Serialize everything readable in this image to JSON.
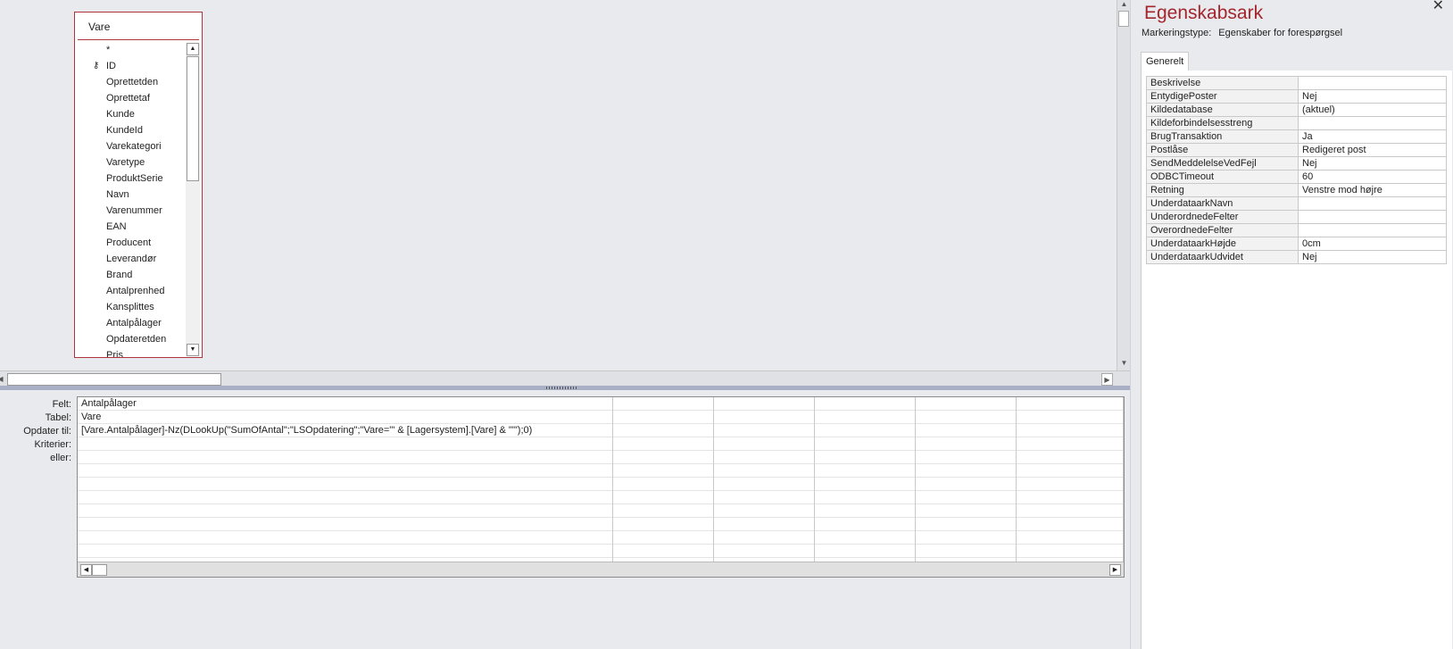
{
  "table_box": {
    "title": "Vare",
    "fields": [
      {
        "label": "*",
        "key": false
      },
      {
        "label": "ID",
        "key": true
      },
      {
        "label": "Oprettetden",
        "key": false
      },
      {
        "label": "Oprettetaf",
        "key": false
      },
      {
        "label": "Kunde",
        "key": false
      },
      {
        "label": "KundeId",
        "key": false
      },
      {
        "label": "Varekategori",
        "key": false
      },
      {
        "label": "Varetype",
        "key": false
      },
      {
        "label": "ProduktSerie",
        "key": false
      },
      {
        "label": "Navn",
        "key": false
      },
      {
        "label": "Varenummer",
        "key": false
      },
      {
        "label": "EAN",
        "key": false
      },
      {
        "label": "Producent",
        "key": false
      },
      {
        "label": "Leverandør",
        "key": false
      },
      {
        "label": "Brand",
        "key": false
      },
      {
        "label": "Antalprenhed",
        "key": false
      },
      {
        "label": "Kansplittes",
        "key": false
      },
      {
        "label": "Antalpålager",
        "key": false
      },
      {
        "label": "Opdateretden",
        "key": false
      },
      {
        "label": "Pris",
        "key": false
      }
    ],
    "key_icon": "key-icon"
  },
  "grid": {
    "row_labels": [
      "Felt:",
      "Tabel:",
      "Opdater til:",
      "Kriterier:",
      "eller:"
    ],
    "columns": [
      {
        "Felt": "Antalpålager",
        "Tabel": "Vare",
        "Opdater": "[Vare.Antalpålager]-Nz(DLookUp(\"SumOfAntal\";\"LSOpdatering\";\"Vare='\" & [Lagersystem].[Vare] & \"'\");0)"
      },
      {
        "Felt": "",
        "Tabel": "",
        "Opdater": ""
      },
      {
        "Felt": "",
        "Tabel": "",
        "Opdater": ""
      },
      {
        "Felt": "",
        "Tabel": "",
        "Opdater": ""
      },
      {
        "Felt": "",
        "Tabel": "",
        "Opdater": ""
      },
      {
        "Felt": "",
        "Tabel": "",
        "Opdater": ""
      }
    ]
  },
  "property_sheet": {
    "title": "Egenskabsark",
    "selection_label": "Markeringstype:",
    "selection_value": "Egenskaber for forespørgsel",
    "tab": "Generelt",
    "close_icon": "close-icon",
    "rows": [
      {
        "name": "Beskrivelse",
        "value": ""
      },
      {
        "name": "EntydigePoster",
        "value": "Nej"
      },
      {
        "name": "Kildedatabase",
        "value": "(aktuel)"
      },
      {
        "name": "Kildeforbindelsesstreng",
        "value": ""
      },
      {
        "name": "BrugTransaktion",
        "value": "Ja"
      },
      {
        "name": "Postlåse",
        "value": "Redigeret post"
      },
      {
        "name": "SendMeddelelseVedFejl",
        "value": "Nej"
      },
      {
        "name": "ODBCTimeout",
        "value": "60"
      },
      {
        "name": "Retning",
        "value": "Venstre mod højre"
      },
      {
        "name": "UnderdataarkNavn",
        "value": ""
      },
      {
        "name": "UnderordnedeFelter",
        "value": ""
      },
      {
        "name": "OverordnedeFelter",
        "value": ""
      },
      {
        "name": "UnderdataarkHøjde",
        "value": "0cm"
      },
      {
        "name": "UnderdataarkUdvidet",
        "value": "Nej"
      }
    ]
  },
  "colors": {
    "accent": "#a4262c",
    "table_border": "#b0343d",
    "splitter": "#a9b0c6"
  }
}
